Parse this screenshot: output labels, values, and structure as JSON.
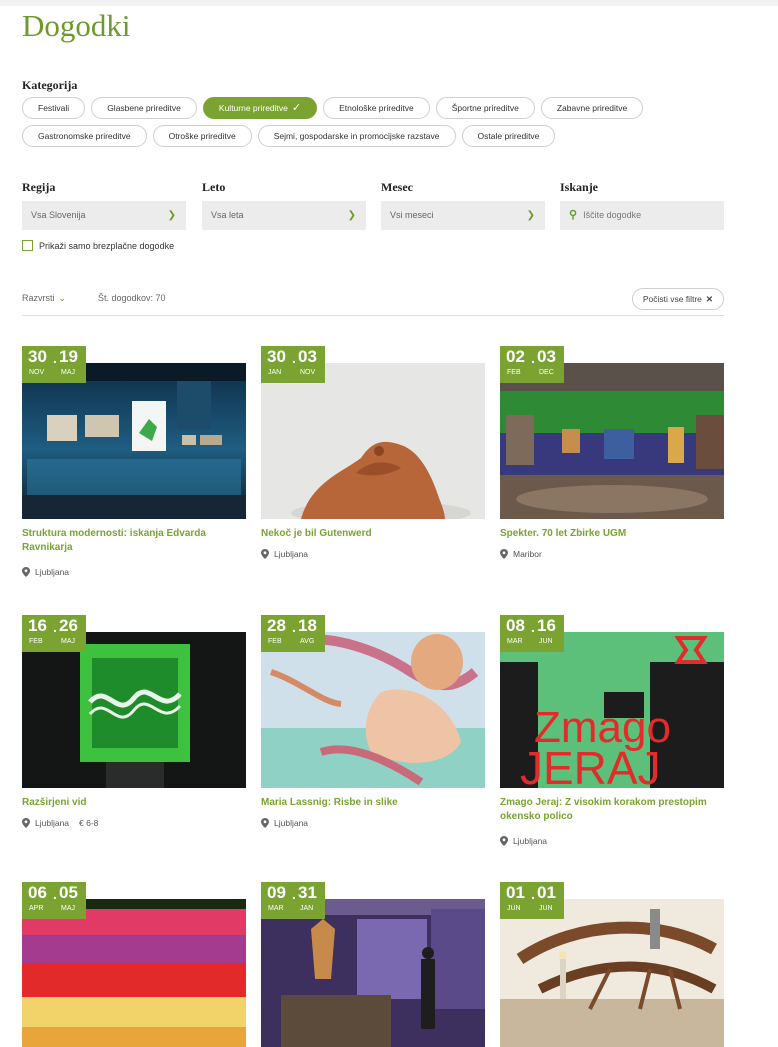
{
  "page": {
    "title": "Dogodki"
  },
  "categories": {
    "label": "Kategorija",
    "items": [
      {
        "label": "Festivali",
        "active": false
      },
      {
        "label": "Glasbene prireditve",
        "active": false
      },
      {
        "label": "Kulturne prireditve",
        "active": true
      },
      {
        "label": "Etnološke prireditve",
        "active": false
      },
      {
        "label": "Športne prireditve",
        "active": false
      },
      {
        "label": "Zabavne prireditve",
        "active": false
      },
      {
        "label": "Gastronomske prireditve",
        "active": false
      },
      {
        "label": "Otroške prireditve",
        "active": false
      },
      {
        "label": "Sejmi, gospodarske in promocijske razstave",
        "active": false
      },
      {
        "label": "Ostale prireditve",
        "active": false
      }
    ]
  },
  "filters": {
    "region": {
      "label": "Regija",
      "value": "Vsa Slovenija"
    },
    "year": {
      "label": "Leto",
      "value": "Vsa leta"
    },
    "month": {
      "label": "Mesec",
      "value": "Vsi meseci"
    },
    "search": {
      "label": "Iskanje",
      "placeholder": "Iščite dogodke"
    },
    "free_only": {
      "label": "Prikaži samo brezplačne dogodke",
      "checked": false
    }
  },
  "toolbar": {
    "sort_label": "Razvrsti",
    "count_label": "Št. dogodkov: 70",
    "reset_label": "Počisti vse filtre"
  },
  "events": [
    {
      "d1": "30",
      "m1": "NOV",
      "d2": "19",
      "m2": "MAJ",
      "title": "Struktura modernosti: iskanja Edvarda Ravnikarja",
      "location": "Ljubljana",
      "price": ""
    },
    {
      "d1": "30",
      "m1": "JAN",
      "d2": "03",
      "m2": "NOV",
      "title": "Nekoč je bil Gutenwerd",
      "location": "Ljubljana",
      "price": ""
    },
    {
      "d1": "02",
      "m1": "FEB",
      "d2": "03",
      "m2": "DEC",
      "title": "Spekter. 70 let Zbirke UGM",
      "location": "Maribor",
      "price": ""
    },
    {
      "d1": "16",
      "m1": "FEB",
      "d2": "26",
      "m2": "MAJ",
      "title": "Razširjeni vid",
      "location": "Ljubljana",
      "price": "€ 6-8"
    },
    {
      "d1": "28",
      "m1": "FEB",
      "d2": "18",
      "m2": "AVG",
      "title": "Maria Lassnig: Risbe in slike",
      "location": "Ljubljana",
      "price": ""
    },
    {
      "d1": "08",
      "m1": "MAR",
      "d2": "16",
      "m2": "JUN",
      "title": "Zmago Jeraj: Z visokim korakom prestopim okensko polico",
      "location": "Ljubljana",
      "price": "",
      "poster": {
        "line1": "Zmago",
        "line2": "JERAJ"
      }
    },
    {
      "d1": "06",
      "m1": "APR",
      "d2": "05",
      "m2": "MAJ",
      "title": "",
      "location": "",
      "price": ""
    },
    {
      "d1": "09",
      "m1": "MAR",
      "d2": "31",
      "m2": "JAN",
      "title": "",
      "location": "",
      "price": ""
    },
    {
      "d1": "01",
      "m1": "JUN",
      "d2": "01",
      "m2": "JUN",
      "title": "",
      "location": "",
      "price": ""
    }
  ],
  "colors": {
    "accent": "#7aa331",
    "title": "#6e9a2b",
    "input_bg": "#ececec"
  }
}
